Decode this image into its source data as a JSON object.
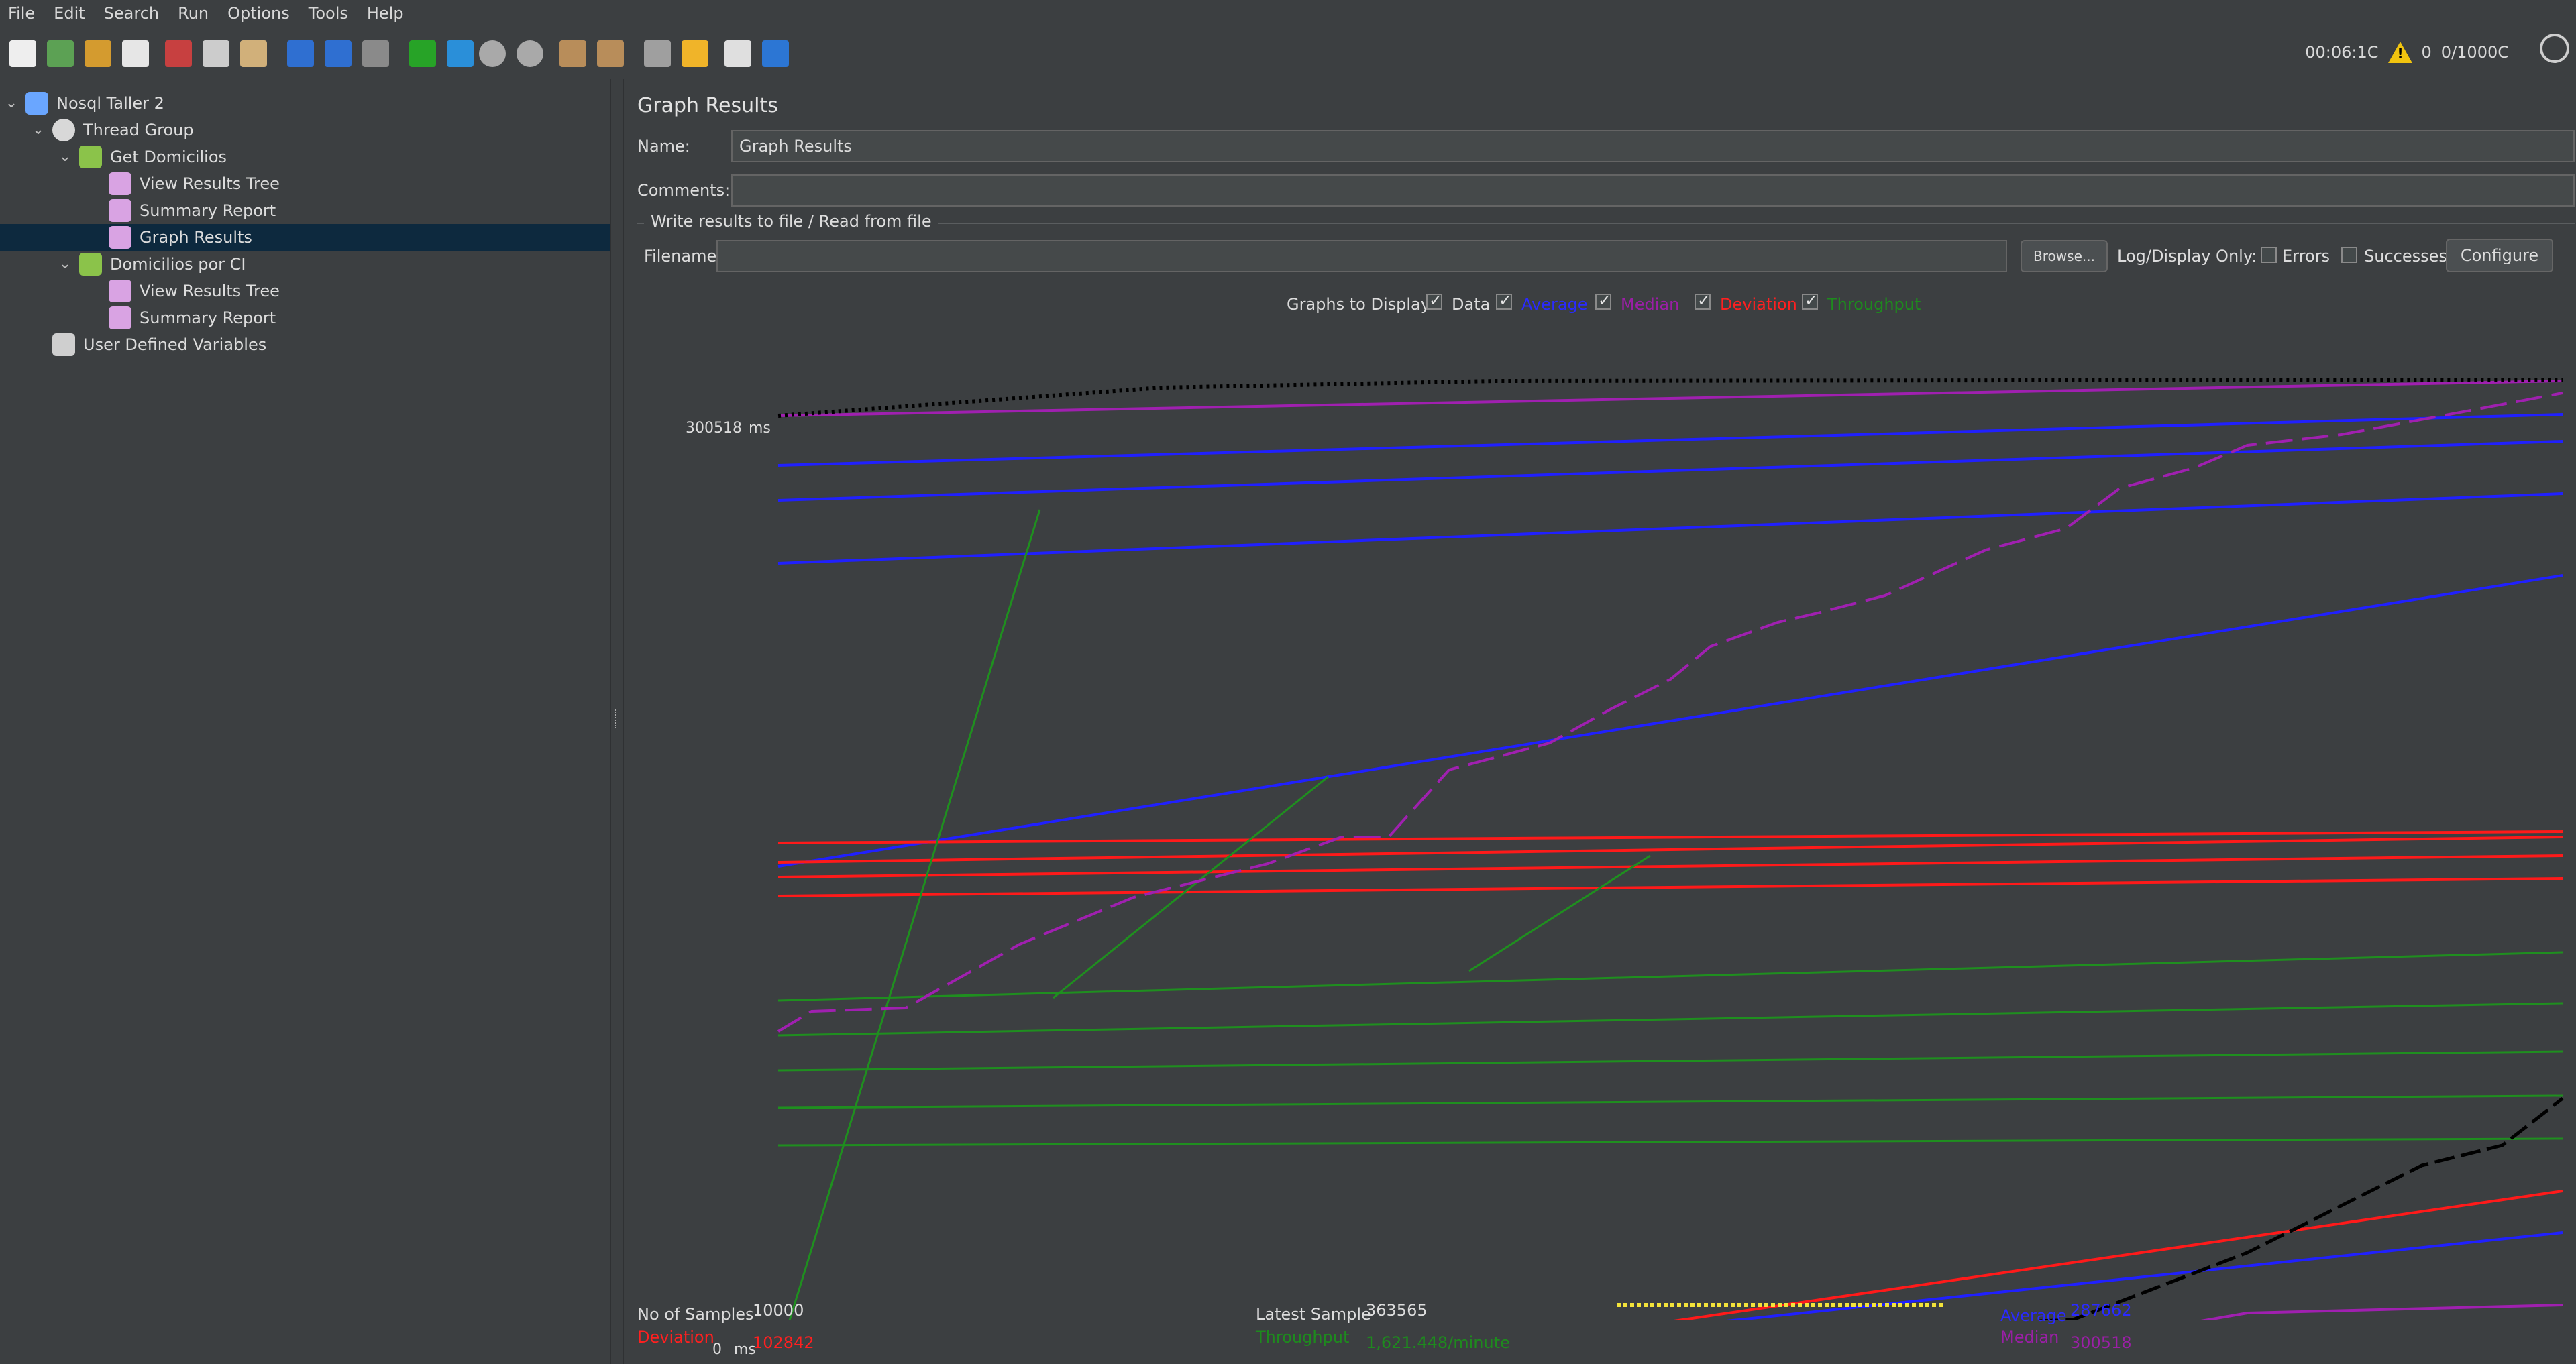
{
  "menu": [
    "File",
    "Edit",
    "Search",
    "Run",
    "Options",
    "Tools",
    "Help"
  ],
  "toolbar": {
    "icons": [
      "new-icon",
      "templates-icon",
      "open-icon",
      "save-icon",
      "cut-icon",
      "copy-icon",
      "paste-icon",
      "expand-icon",
      "collapse-icon",
      "toggle-icon",
      "start-icon",
      "start-no-pauses-icon",
      "stop-icon",
      "shutdown-icon",
      "clear-icon",
      "clear-all-icon",
      "search-icon",
      "reset-search-icon",
      "function-helper-icon",
      "help-icon"
    ],
    "elapsed": "00:06:1C",
    "errors": "0",
    "threads": "0/1000C"
  },
  "tree": [
    {
      "label": "Nosql Taller 2",
      "level": 0,
      "expanded": true,
      "icon": "testplan-icon"
    },
    {
      "label": "Thread Group",
      "level": 1,
      "expanded": true,
      "icon": "gear-icon"
    },
    {
      "label": "Get Domicilios",
      "level": 2,
      "expanded": true,
      "icon": "sampler-icon"
    },
    {
      "label": "View Results Tree",
      "level": 3,
      "icon": "listener-icon"
    },
    {
      "label": "Summary Report",
      "level": 3,
      "icon": "listener-icon"
    },
    {
      "label": "Graph Results",
      "level": 3,
      "icon": "listener-icon",
      "selected": true
    },
    {
      "label": "Domicilios por CI",
      "level": 2,
      "expanded": true,
      "icon": "sampler-icon"
    },
    {
      "label": "View Results Tree",
      "level": 3,
      "icon": "listener-icon"
    },
    {
      "label": "Summary Report",
      "level": 3,
      "icon": "listener-icon"
    },
    {
      "label": "User Defined Variables",
      "level": 1,
      "icon": "tools-icon"
    }
  ],
  "panel": {
    "title": "Graph Results",
    "name_label": "Name:",
    "name_value": "Graph Results",
    "comments_label": "Comments:",
    "comments_value": "",
    "group_title": "Write results to file / Read from file",
    "filename_label": "Filename",
    "filename_value": "",
    "browse": "Browse...",
    "log_display_only": "Log/Display Only:",
    "errors_label": "Errors",
    "successes_label": "Successes",
    "configure": "Configure",
    "graphs_to_display": "Graphs to Display",
    "graph_checks": [
      {
        "label": "Data",
        "color": "#dcdcdc",
        "checked": true
      },
      {
        "label": "Average",
        "color": "#2a2aff",
        "checked": true
      },
      {
        "label": "Median",
        "color": "#9b1fa6",
        "checked": true
      },
      {
        "label": "Deviation",
        "color": "#ff2020",
        "checked": true
      },
      {
        "label": "Throughput",
        "color": "#1e8a1e",
        "checked": true
      }
    ]
  },
  "graph": {
    "y_max": "300518",
    "y_min": "0",
    "unit": "ms",
    "colors": {
      "data": "#000000",
      "average": "#2020ff",
      "median": "#a020b0",
      "deviation": "#ff1a1a",
      "throughput": "#1f8f1f",
      "highlight": "#f3e33a"
    }
  },
  "stats": {
    "samples_label": "No of Samples",
    "samples_value": "10000",
    "latest_label": "Latest Sample",
    "latest_value": "363565",
    "average_label": "Average",
    "average_value": "287662",
    "deviation_label": "Deviation",
    "deviation_value": "102842",
    "throughput_label": "Throughput",
    "throughput_value": "1,621.448/minute",
    "median_label": "Median",
    "median_value": "300518"
  }
}
